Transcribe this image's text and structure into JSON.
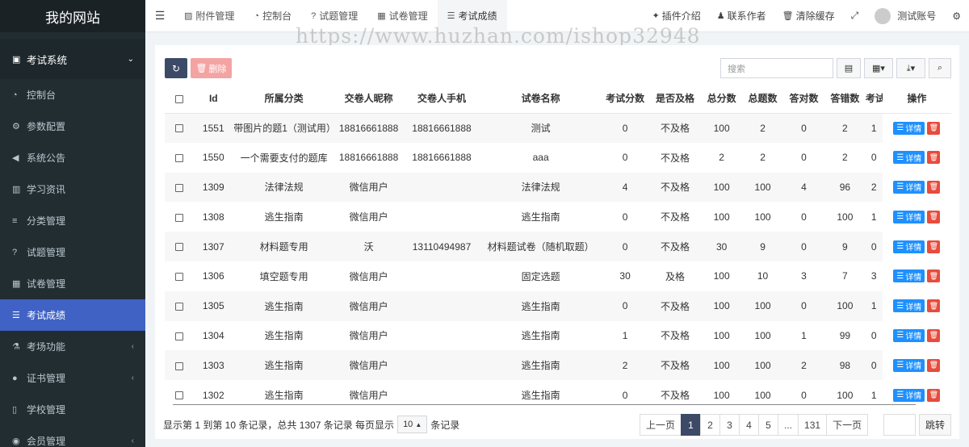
{
  "site_title": "我的网站",
  "sidebar": {
    "group": {
      "label": "考试系统",
      "icon": "book-icon"
    },
    "items": [
      {
        "label": "控制台",
        "icon": "dashboard-icon"
      },
      {
        "label": "参数配置",
        "icon": "cogs-icon"
      },
      {
        "label": "系统公告",
        "icon": "volume-icon"
      },
      {
        "label": "学习资讯",
        "icon": "map-icon"
      },
      {
        "label": "分类管理",
        "icon": "align-left-icon"
      },
      {
        "label": "试题管理",
        "icon": "question-circle-icon"
      },
      {
        "label": "试卷管理",
        "icon": "keyboard-icon"
      },
      {
        "label": "考试成绩",
        "icon": "list-icon",
        "active": true
      },
      {
        "label": "考场功能",
        "icon": "flask-icon"
      },
      {
        "label": "证书管理",
        "icon": "circle-icon"
      },
      {
        "label": "学校管理",
        "icon": "tablet-icon"
      },
      {
        "label": "会员管理",
        "icon": "user-circle-icon"
      }
    ]
  },
  "topbar": {
    "tabs": [
      {
        "label": "附件管理",
        "icon": "file-image-icon"
      },
      {
        "label": "控制台",
        "icon": "dashboard-icon"
      },
      {
        "label": "试题管理",
        "icon": "question-circle-icon"
      },
      {
        "label": "试卷管理",
        "icon": "keyboard-icon"
      },
      {
        "label": "考试成绩",
        "icon": "list-icon",
        "active": true
      }
    ],
    "links": [
      {
        "label": "插件介绍",
        "icon": "magic-icon"
      },
      {
        "label": "联系作者",
        "icon": "user-secret-icon"
      },
      {
        "label": "清除缓存",
        "icon": "trash-icon"
      }
    ],
    "user": "测试账号"
  },
  "watermark": "https://www.huzhan.com/ishop32948",
  "toolbar": {
    "delete_label": "删除",
    "search_placeholder": "搜索"
  },
  "table": {
    "columns": [
      "Id",
      "所属分类",
      "交卷人昵称",
      "交卷人手机",
      "试卷名称",
      "考试分数",
      "是否及格",
      "总分数",
      "总题数",
      "答对数",
      "答错数",
      "考试",
      "操作"
    ],
    "detail_label": "详情",
    "rows": [
      {
        "id": "1551",
        "category": "带图片的题1（测试用）",
        "nickname": "18816661888",
        "mobile": "18816661888",
        "paper": "测试",
        "score": "0",
        "pass": "不及格",
        "total_score": "100",
        "total_q": "2",
        "right": "0",
        "wrong": "2",
        "extra": "1"
      },
      {
        "id": "1550",
        "category": "一个需要支付的题库",
        "nickname": "18816661888",
        "mobile": "18816661888",
        "paper": "aaa",
        "score": "0",
        "pass": "不及格",
        "total_score": "2",
        "total_q": "2",
        "right": "0",
        "wrong": "2",
        "extra": "0"
      },
      {
        "id": "1309",
        "category": "法律法规",
        "nickname": "微信用户",
        "mobile": "",
        "paper": "法律法规",
        "score": "4",
        "pass": "不及格",
        "total_score": "100",
        "total_q": "100",
        "right": "4",
        "wrong": "96",
        "extra": "2"
      },
      {
        "id": "1308",
        "category": "逃生指南",
        "nickname": "微信用户",
        "mobile": "",
        "paper": "逃生指南",
        "score": "0",
        "pass": "不及格",
        "total_score": "100",
        "total_q": "100",
        "right": "0",
        "wrong": "100",
        "extra": "1"
      },
      {
        "id": "1307",
        "category": "材料题专用",
        "nickname": "沃",
        "mobile": "13110494987",
        "paper": "材料题试卷（随机取题）",
        "score": "0",
        "pass": "不及格",
        "total_score": "30",
        "total_q": "9",
        "right": "0",
        "wrong": "9",
        "extra": "0"
      },
      {
        "id": "1306",
        "category": "填空题专用",
        "nickname": "微信用户",
        "mobile": "",
        "paper": "固定选题",
        "score": "30",
        "pass": "及格",
        "total_score": "100",
        "total_q": "10",
        "right": "3",
        "wrong": "7",
        "extra": "3"
      },
      {
        "id": "1305",
        "category": "逃生指南",
        "nickname": "微信用户",
        "mobile": "",
        "paper": "逃生指南",
        "score": "0",
        "pass": "不及格",
        "total_score": "100",
        "total_q": "100",
        "right": "0",
        "wrong": "100",
        "extra": "1"
      },
      {
        "id": "1304",
        "category": "逃生指南",
        "nickname": "微信用户",
        "mobile": "",
        "paper": "逃生指南",
        "score": "1",
        "pass": "不及格",
        "total_score": "100",
        "total_q": "100",
        "right": "1",
        "wrong": "99",
        "extra": "0"
      },
      {
        "id": "1303",
        "category": "逃生指南",
        "nickname": "微信用户",
        "mobile": "",
        "paper": "逃生指南",
        "score": "2",
        "pass": "不及格",
        "total_score": "100",
        "total_q": "100",
        "right": "2",
        "wrong": "98",
        "extra": "0"
      },
      {
        "id": "1302",
        "category": "逃生指南",
        "nickname": "微信用户",
        "mobile": "",
        "paper": "逃生指南",
        "score": "0",
        "pass": "不及格",
        "total_score": "100",
        "total_q": "100",
        "right": "0",
        "wrong": "100",
        "extra": "1"
      }
    ]
  },
  "footer": {
    "info_before": "显示第 1 到第 10 条记录，总共 1307 条记录 每页显示",
    "page_size": "10",
    "info_after": "条记录",
    "pages": [
      "上一页",
      "1",
      "2",
      "3",
      "4",
      "5",
      "...",
      "131",
      "下一页"
    ],
    "current_page": "1",
    "jump_label": "跳转"
  }
}
